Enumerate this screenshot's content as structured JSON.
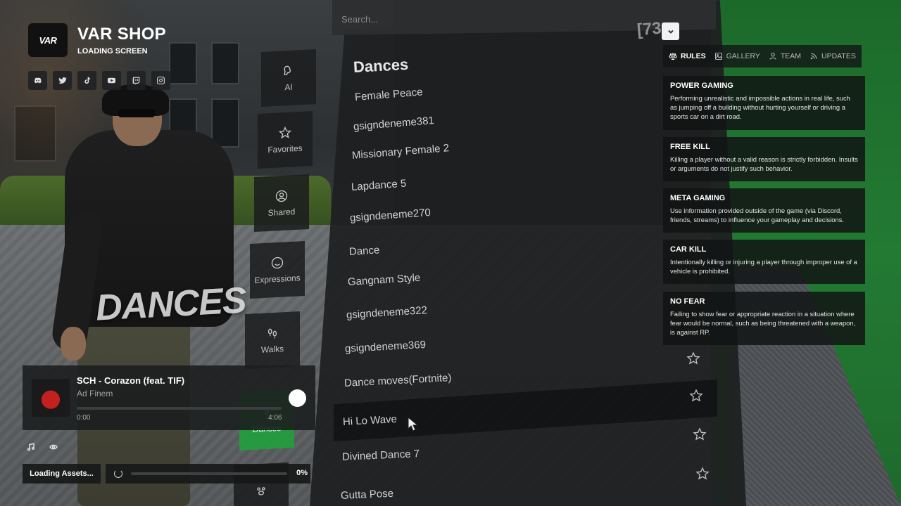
{
  "brand": {
    "logo_text": "VAR",
    "title": "VAR SHOP",
    "subtitle": "LOADING SCREEN"
  },
  "socials": [
    {
      "icon": "discord-icon"
    },
    {
      "icon": "twitter-icon"
    },
    {
      "icon": "tiktok-icon"
    },
    {
      "icon": "youtube-icon"
    },
    {
      "icon": "twitch-icon"
    },
    {
      "icon": "instagram-icon"
    }
  ],
  "categories": {
    "ai": "AI",
    "favorites": "Favorites",
    "shared": "Shared",
    "expressions": "Expressions",
    "walks": "Walks",
    "dances": "Dances"
  },
  "watermark": "DANCES",
  "emote_list": {
    "search_placeholder": "Search...",
    "count": "[73",
    "title": "Dances",
    "items": [
      "Female Peace",
      "gsigndeneme381",
      "Missionary Female 2",
      "Lapdance 5",
      "gsigndeneme270",
      "Dance",
      "Gangnam Style",
      "gsigndeneme322",
      "gsigndeneme369",
      "Dance moves(Fortnite)",
      "Hi Lo Wave",
      "Divined Dance 7",
      "Gutta Pose"
    ]
  },
  "rules_panel": {
    "tabs": [
      {
        "label": "RULES",
        "icon": "scale-icon",
        "active": true
      },
      {
        "label": "GALLERY",
        "icon": "image-icon",
        "active": false
      },
      {
        "label": "TEAM",
        "icon": "user-icon",
        "active": false
      },
      {
        "label": "UPDATES",
        "icon": "rss-icon",
        "active": false
      }
    ],
    "rules": [
      {
        "title": "POWER GAMING",
        "text": "Performing unrealistic and impossible actions in real life, such as jumping off a building without hurting yourself or driving a sports car on a dirt road."
      },
      {
        "title": "FREE KILL",
        "text": "Killing a player without a valid reason is strictly forbidden. Insults or arguments do not justify such behavior."
      },
      {
        "title": "META GAMING",
        "text": "Use information provided outside of the game (via Discord, friends, streams) to influence your gameplay and decisions."
      },
      {
        "title": "CAR KILL",
        "text": "Intentionally killing or injuring a player through improper use of a vehicle is prohibited."
      },
      {
        "title": "NO FEAR",
        "text": "Failing to show fear or appropriate reaction in a situation where fear would be normal, such as being threatened with a weapon, is against RP."
      }
    ]
  },
  "player": {
    "title": "SCH - Corazon (feat. TIF)",
    "artist": "Ad Finem",
    "current_time": "0:00",
    "duration": "4:06",
    "progress": 0.0
  },
  "loading": {
    "label": "Loading Assets...",
    "percent_text": "0%",
    "progress": 0.0
  },
  "colors": {
    "accent_green": "#21a03c",
    "panel_bg": "#1e1f20"
  }
}
